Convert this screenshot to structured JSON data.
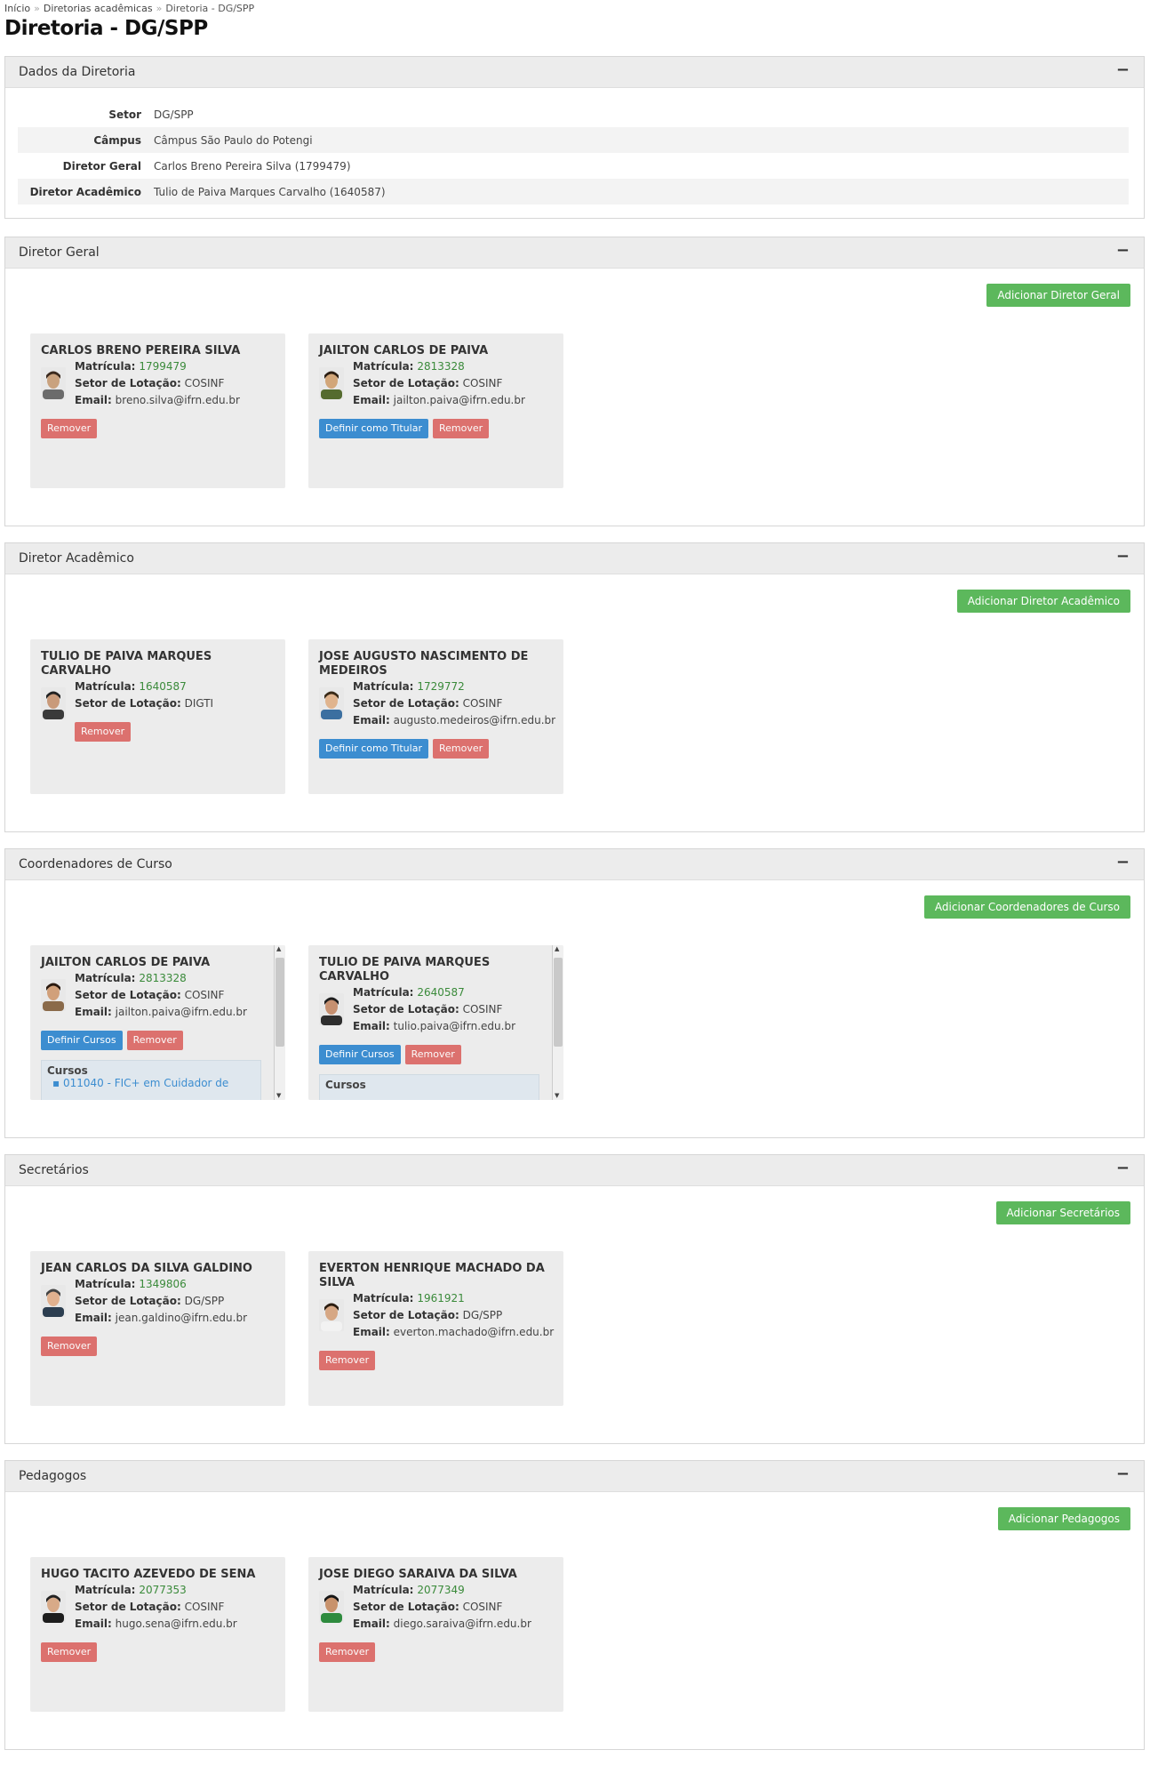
{
  "breadcrumb": [
    "Início",
    "Diretorias acadêmicas",
    "Diretoria - DG/SPP"
  ],
  "page_title": "Diretoria - DG/SPP",
  "dados": {
    "title": "Dados da Diretoria",
    "collapse": "−",
    "rows": [
      {
        "k": "Setor",
        "v": "DG/SPP"
      },
      {
        "k": "Câmpus",
        "v": "Câmpus São Paulo do Potengi"
      },
      {
        "k": "Diretor Geral",
        "v": "Carlos Breno Pereira Silva (1799479)"
      },
      {
        "k": "Diretor Acadêmico",
        "v": "Tulio de Paiva Marques Carvalho (1640587)"
      }
    ]
  },
  "labels": {
    "matricula": "Matrícula:",
    "setor": "Setor de Lotação:",
    "email": "Email:",
    "remover": "Remover",
    "definir_titular": "Definir como Titular",
    "definir_cursos": "Definir Cursos",
    "cursos": "Cursos"
  },
  "sections": [
    {
      "title": "Diretor Geral",
      "collapse": "−",
      "add_label": "Adicionar Diretor Geral",
      "cards": [
        {
          "name": "CARLOS BRENO PEREIRA SILVA",
          "matricula": "1799479",
          "setor": "COSINF",
          "email": "breno.silva@ifrn.edu.br"
        },
        {
          "name": "JAILTON CARLOS DE PAIVA",
          "matricula": "2813328",
          "setor": "COSINF",
          "email": "jailton.paiva@ifrn.edu.br"
        }
      ]
    },
    {
      "title": "Diretor Acadêmico",
      "collapse": "−",
      "add_label": "Adicionar Diretor Acadêmico",
      "cards": [
        {
          "name": "TULIO DE PAIVA MARQUES CARVALHO",
          "matricula": "1640587",
          "setor": "DIGTI",
          "email": ""
        },
        {
          "name": "JOSE AUGUSTO NASCIMENTO DE MEDEIROS",
          "matricula": "1729772",
          "setor": "COSINF",
          "email": "augusto.medeiros@ifrn.edu.br"
        }
      ]
    },
    {
      "title": "Coordenadores de Curso",
      "collapse": "−",
      "add_label": "Adicionar Coordenadores de Curso",
      "cards": [
        {
          "name": "JAILTON CARLOS DE PAIVA",
          "matricula": "2813328",
          "setor": "COSINF",
          "email": "jailton.paiva@ifrn.edu.br",
          "cursos": [
            "011040 - FIC+ em Cuidador de"
          ]
        },
        {
          "name": "TULIO DE PAIVA MARQUES CARVALHO",
          "matricula": "2640587",
          "setor": "COSINF",
          "email": "tulio.paiva@ifrn.edu.br",
          "cursos": []
        }
      ]
    },
    {
      "title": "Secretários",
      "collapse": "−",
      "add_label": "Adicionar Secretários",
      "cards": [
        {
          "name": "JEAN CARLOS DA SILVA GALDINO",
          "matricula": "1349806",
          "setor": "DG/SPP",
          "email": "jean.galdino@ifrn.edu.br"
        },
        {
          "name": "EVERTON HENRIQUE MACHADO DA SILVA",
          "matricula": "1961921",
          "setor": "DG/SPP",
          "email": "everton.machado@ifrn.edu.br"
        }
      ]
    },
    {
      "title": "Pedagogos",
      "collapse": "−",
      "add_label": "Adicionar Pedagogos",
      "cards": [
        {
          "name": "HUGO TACITO AZEVEDO DE SENA",
          "matricula": "2077353",
          "setor": "COSINF",
          "email": "hugo.sena@ifrn.edu.br"
        },
        {
          "name": "JOSE DIEGO SARAIVA DA SILVA",
          "matricula": "2077349",
          "setor": "COSINF",
          "email": "diego.saraiva@ifrn.edu.br"
        }
      ]
    }
  ]
}
